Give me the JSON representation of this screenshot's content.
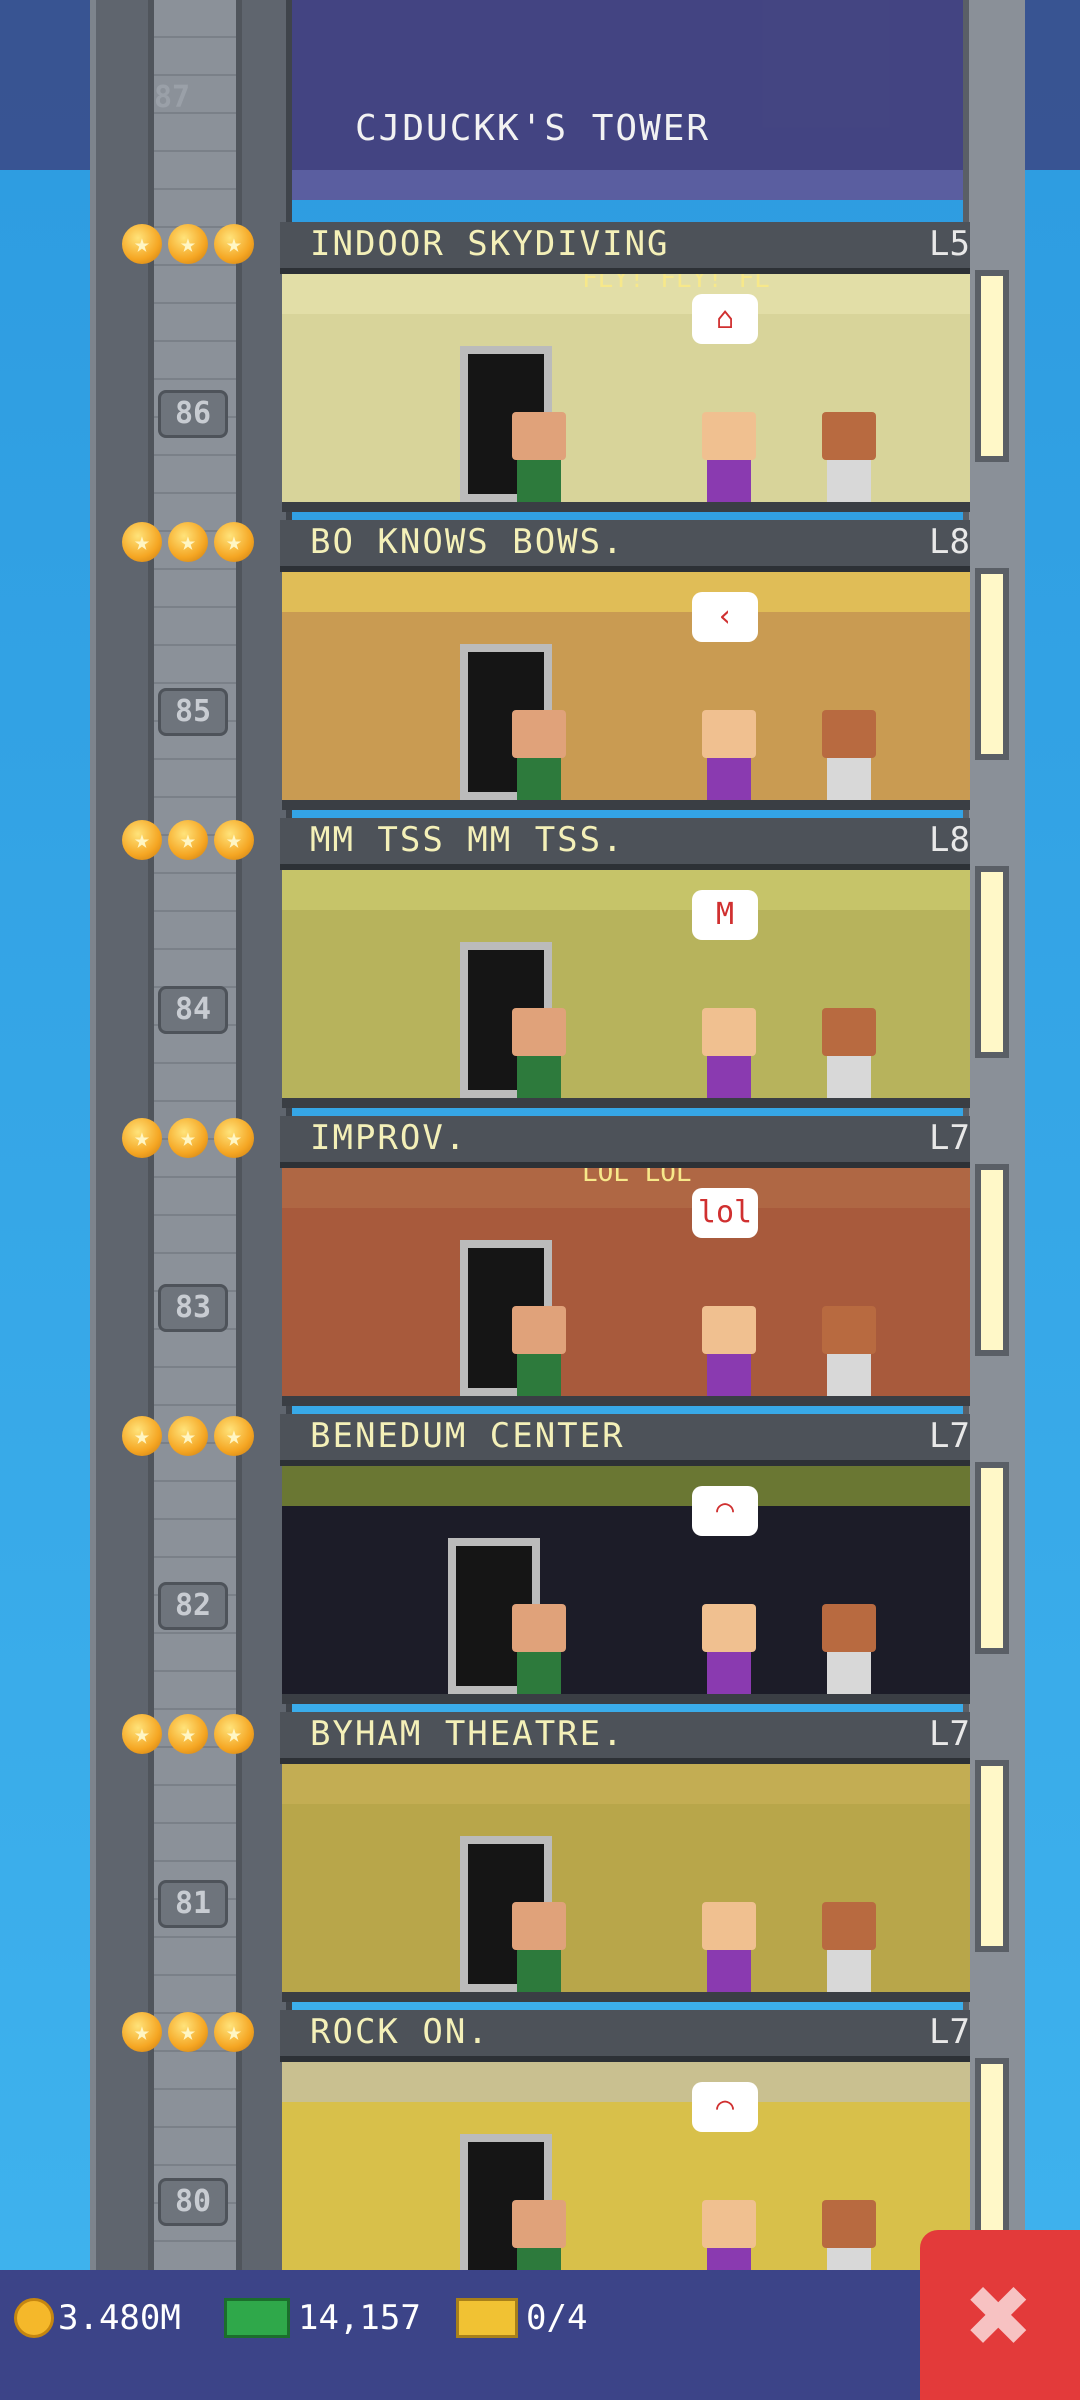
{
  "tower": {
    "title": "CJDUCKK'S TOWER",
    "top_floor_number": "87"
  },
  "floors": [
    {
      "stars": [
        "★",
        "★",
        "★"
      ],
      "name": "INDOOR SKYDIVING",
      "level": "L5",
      "number": "86",
      "sign": "FLY! FLY! FL",
      "bubble": "⌂"
    },
    {
      "stars": [
        "★",
        "★",
        "★"
      ],
      "name": "BO KNOWS BOWS.",
      "level": "L8",
      "number": "85",
      "bubble": "‹"
    },
    {
      "stars": [
        "★",
        "★",
        "★"
      ],
      "name": "MM TSS MM TSS.",
      "level": "L8",
      "number": "84",
      "bubble": "M"
    },
    {
      "stars": [
        "★",
        "★",
        "★"
      ],
      "name": "IMPROV.",
      "level": "L7",
      "number": "83",
      "bubble": "lol",
      "sign": "LOL LOL"
    },
    {
      "stars": [
        "★",
        "★",
        "★"
      ],
      "name": "BENEDUM CENTER",
      "level": "L7",
      "number": "82",
      "bubble": "◠"
    },
    {
      "stars": [
        "★",
        "★",
        "★"
      ],
      "name": "BYHAM THEATRE.",
      "level": "L7",
      "number": "81"
    },
    {
      "stars": [
        "★",
        "★",
        "★"
      ],
      "name": "ROCK ON.",
      "level": "L7",
      "number": "80",
      "bubble": "⌒"
    }
  ],
  "stats": {
    "coins": "3.480M",
    "bux": "14,157",
    "tickets": "0/4"
  },
  "close_label": "✖",
  "colors": {
    "sky": "#39a9e6",
    "bar": "#3c4488",
    "close": "#e33a3a",
    "floor_label": "#f4f0b8"
  }
}
